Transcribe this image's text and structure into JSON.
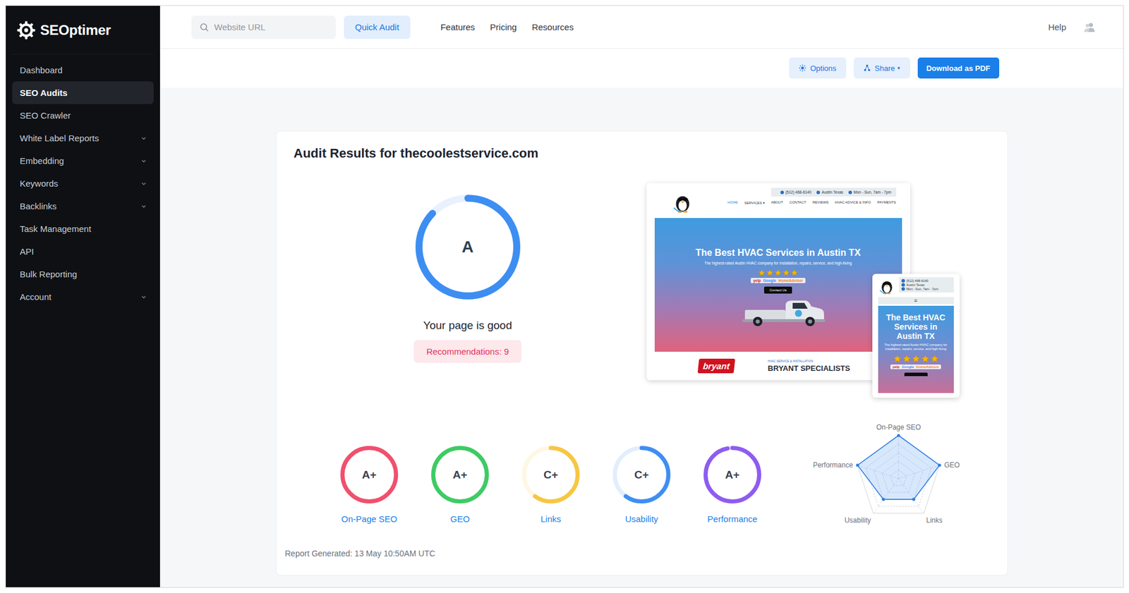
{
  "brand": {
    "name": "SEOptimer"
  },
  "sidebar": {
    "items": [
      {
        "label": "Dashboard",
        "selected": false,
        "expandable": false
      },
      {
        "label": "SEO Audits",
        "selected": true,
        "expandable": false
      },
      {
        "label": "SEO Crawler",
        "selected": false,
        "expandable": false
      },
      {
        "label": "White Label Reports",
        "selected": false,
        "expandable": true
      },
      {
        "label": "Embedding",
        "selected": false,
        "expandable": true
      },
      {
        "label": "Keywords",
        "selected": false,
        "expandable": true
      },
      {
        "label": "Backlinks",
        "selected": false,
        "expandable": true
      },
      {
        "label": "Task Management",
        "selected": false,
        "expandable": false
      },
      {
        "label": "API",
        "selected": false,
        "expandable": false
      },
      {
        "label": "Bulk Reporting",
        "selected": false,
        "expandable": false
      },
      {
        "label": "Account",
        "selected": false,
        "expandable": true
      }
    ]
  },
  "topbar": {
    "search_placeholder": "Website URL",
    "quick_audit": "Quick Audit",
    "nav": [
      "Features",
      "Pricing",
      "Resources"
    ],
    "help": "Help"
  },
  "toolbar": {
    "options": "Options",
    "share": "Share",
    "share_caret": "▾",
    "download": "Download as PDF"
  },
  "audit": {
    "title": "Audit Results for thecoolestservice.com",
    "grade": "A",
    "level": 0.87,
    "verdict": "Your page is good",
    "recommendations": "Recommendations: 9",
    "generated": "Report Generated: 13 May 10:50AM UTC"
  },
  "categories": [
    {
      "name": "On-Page SEO",
      "grade": "A+",
      "level": 1,
      "color": "#f0506e"
    },
    {
      "name": "GEO",
      "grade": "A+",
      "level": 1,
      "color": "#3ecb64"
    },
    {
      "name": "Links",
      "grade": "C+",
      "level": 0.6,
      "color": "#f6c744"
    },
    {
      "name": "Usability",
      "grade": "C+",
      "level": 0.6,
      "color": "#3f8ef3"
    },
    {
      "name": "Performance",
      "grade": "A+",
      "level": 0.97,
      "color": "#8e5cf0"
    }
  ],
  "radar": {
    "axes": [
      "On-Page SEO",
      "GEO",
      "Links",
      "Usability",
      "Performance"
    ],
    "values": [
      100,
      100,
      60,
      60,
      100
    ],
    "max": 100
  },
  "preview": {
    "desktop": {
      "phone": "(512) 468-6140",
      "location": "Austin Texas",
      "hours": "Mon - Sun, 7am - 7pm",
      "nav": [
        {
          "label": "HOME",
          "selected": true
        },
        {
          "label": "SERVICES ▾",
          "selected": false
        },
        {
          "label": "ABOUT",
          "selected": false
        },
        {
          "label": "CONTACT",
          "selected": false
        },
        {
          "label": "REVIEWS",
          "selected": false
        },
        {
          "label": "HVAC ADVICE & INFO",
          "selected": false
        },
        {
          "label": "PAYMENTS",
          "selected": false
        }
      ],
      "headline": "The Best HVAC Services in Austin TX",
      "tagline": "The highest-rated Austin HVAC company for installation, repairs, service, and high-fixing",
      "stars": 5,
      "reviews": [
        "yelp",
        "Google",
        "HomeAdvisor"
      ],
      "cta": "Contact Us",
      "brand_badge": "bryant",
      "kicker": "HVAC SERVICE & INSTALLATION",
      "section": "BRYANT SPECIALISTS"
    },
    "mobile": {
      "phone": "(512) 468-6140",
      "location": "Austin Texas",
      "hours": "Mon - Sun, 7am - 7pm",
      "menu": "≡",
      "headline": "The Best HVAC Services in Austin TX",
      "tagline": "The highest-rated Austin HVAC company for installation, repairs, service, and high-fixing",
      "stars": 5,
      "reviews": [
        "yelp",
        "Google",
        "HomeAdvisor"
      ]
    }
  }
}
